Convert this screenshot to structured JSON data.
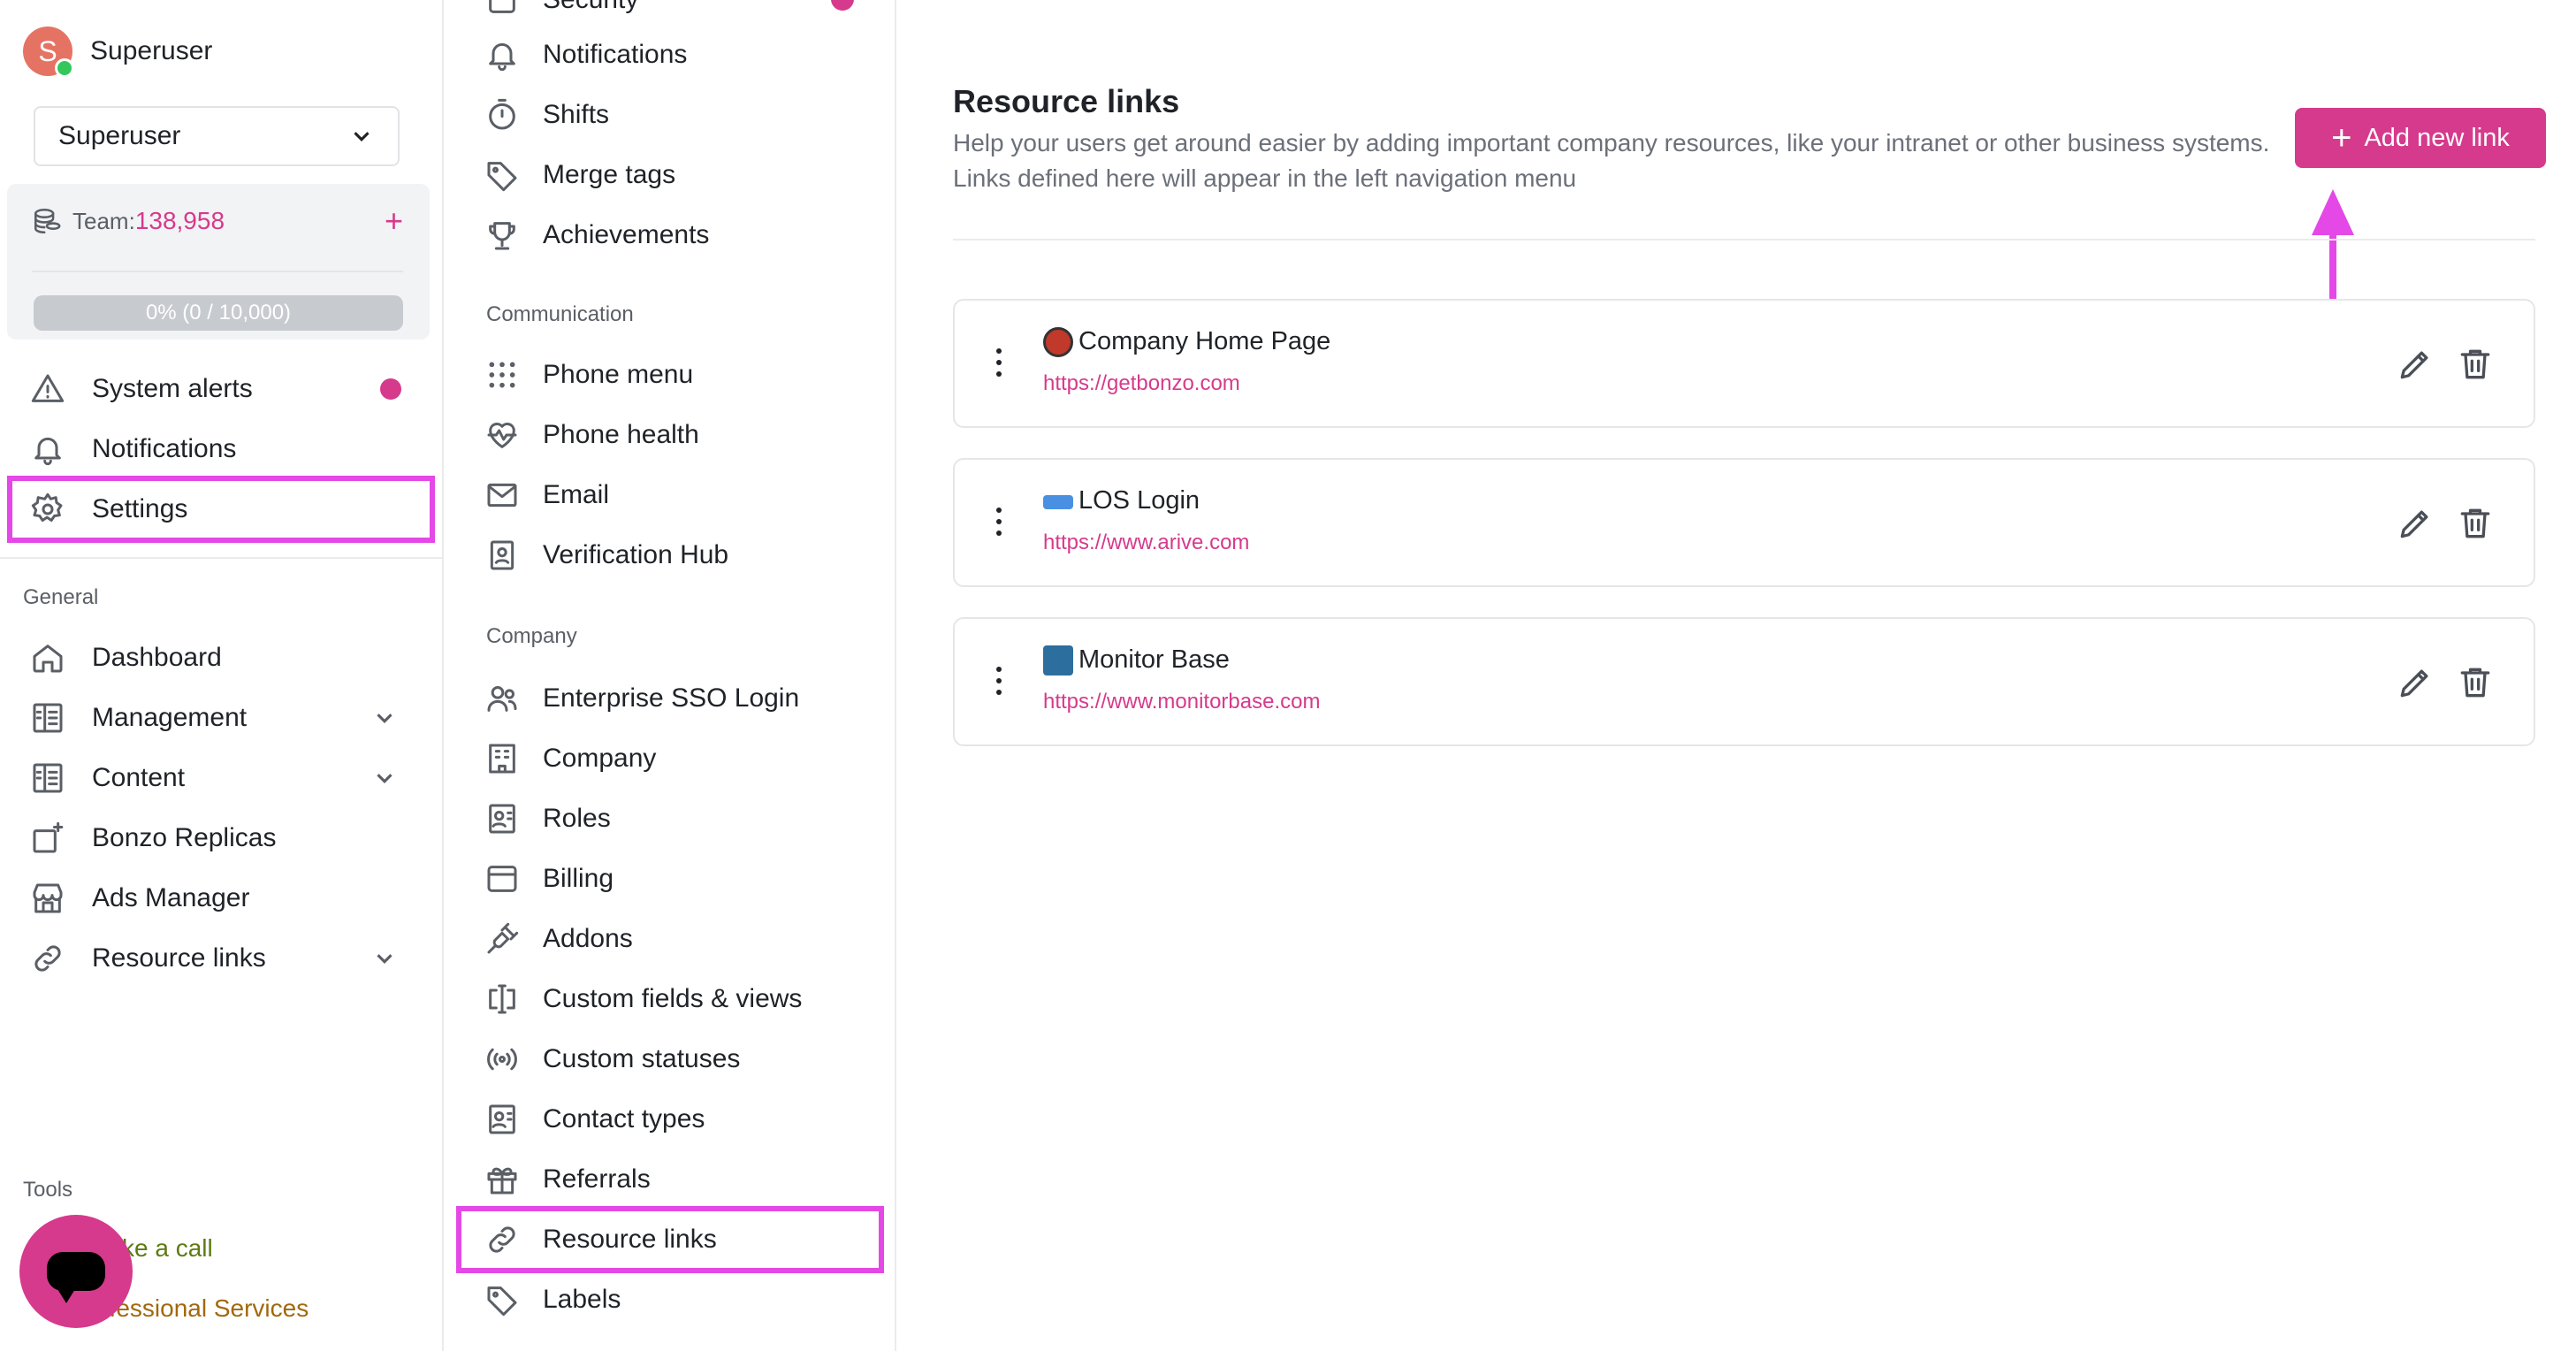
{
  "user": {
    "initial": "S",
    "name": "Superuser"
  },
  "account_select": {
    "value": "Superuser"
  },
  "team": {
    "label": "Team:",
    "value": "138,958",
    "progress_text": "0% (0 / 10,000)",
    "progress_fraction": 0
  },
  "sidebar": {
    "top_items": [
      {
        "label": "System alerts",
        "icon": "warning-icon",
        "has_dot": true
      },
      {
        "label": "Notifications",
        "icon": "bell-icon"
      },
      {
        "label": "Settings",
        "icon": "gear-icon"
      }
    ],
    "general_label": "General",
    "general_items": [
      {
        "label": "Dashboard",
        "icon": "home-icon"
      },
      {
        "label": "Management",
        "icon": "management-icon",
        "expandable": true
      },
      {
        "label": "Content",
        "icon": "content-icon",
        "expandable": true
      },
      {
        "label": "Bonzo Replicas",
        "icon": "replicas-icon"
      },
      {
        "label": "Ads Manager",
        "icon": "store-icon"
      },
      {
        "label": "Resource links",
        "icon": "link-icon",
        "expandable": true
      }
    ],
    "tools_label": "Tools",
    "tools_items": [
      {
        "label": "ke a call"
      },
      {
        "label": "ofessional Services"
      }
    ]
  },
  "settings_nav": {
    "partial_top": "Security",
    "items_top": [
      {
        "label": "Notifications",
        "icon": "bell-icon"
      },
      {
        "label": "Shifts",
        "icon": "stopwatch-icon"
      },
      {
        "label": "Merge tags",
        "icon": "tag-icon"
      },
      {
        "label": "Achievements",
        "icon": "trophy-icon"
      }
    ],
    "communication_label": "Communication",
    "communication_items": [
      {
        "label": "Phone menu",
        "icon": "dialpad-icon"
      },
      {
        "label": "Phone health",
        "icon": "heartbeat-icon"
      },
      {
        "label": "Email",
        "icon": "mail-icon"
      },
      {
        "label": "Verification Hub",
        "icon": "id-card-icon"
      }
    ],
    "company_label": "Company",
    "company_items": [
      {
        "label": "Enterprise SSO Login",
        "icon": "users-icon"
      },
      {
        "label": "Company",
        "icon": "building-icon"
      },
      {
        "label": "Roles",
        "icon": "roles-icon"
      },
      {
        "label": "Billing",
        "icon": "billing-icon"
      },
      {
        "label": "Addons",
        "icon": "plug-icon"
      },
      {
        "label": "Custom fields & views",
        "icon": "text-cursor-icon"
      },
      {
        "label": "Custom statuses",
        "icon": "broadcast-icon"
      },
      {
        "label": "Contact types",
        "icon": "contact-card-icon"
      },
      {
        "label": "Referrals",
        "icon": "gift-icon"
      },
      {
        "label": "Resource links",
        "icon": "link-icon"
      },
      {
        "label": "Labels",
        "icon": "tag-icon"
      }
    ]
  },
  "main": {
    "title": "Resource links",
    "description": "Help your users get around easier by adding important company resources, like your intranet or other business systems. Links defined here will appear in the left navigation menu",
    "add_button": "Add new link",
    "links": [
      {
        "title": "Company Home Page",
        "url": "https://getbonzo.com",
        "emoji_color": "#c0392b"
      },
      {
        "title": "LOS Login",
        "url": "https://www.arive.com",
        "emoji_color": "#4a90e2"
      },
      {
        "title": "Monitor Base",
        "url": "https://www.monitorbase.com",
        "emoji_color": "#2c6e9e"
      }
    ]
  },
  "colors": {
    "accent": "#d63a8c",
    "highlight": "#e448e6",
    "text": "#1f2328",
    "muted": "#6b7079"
  }
}
